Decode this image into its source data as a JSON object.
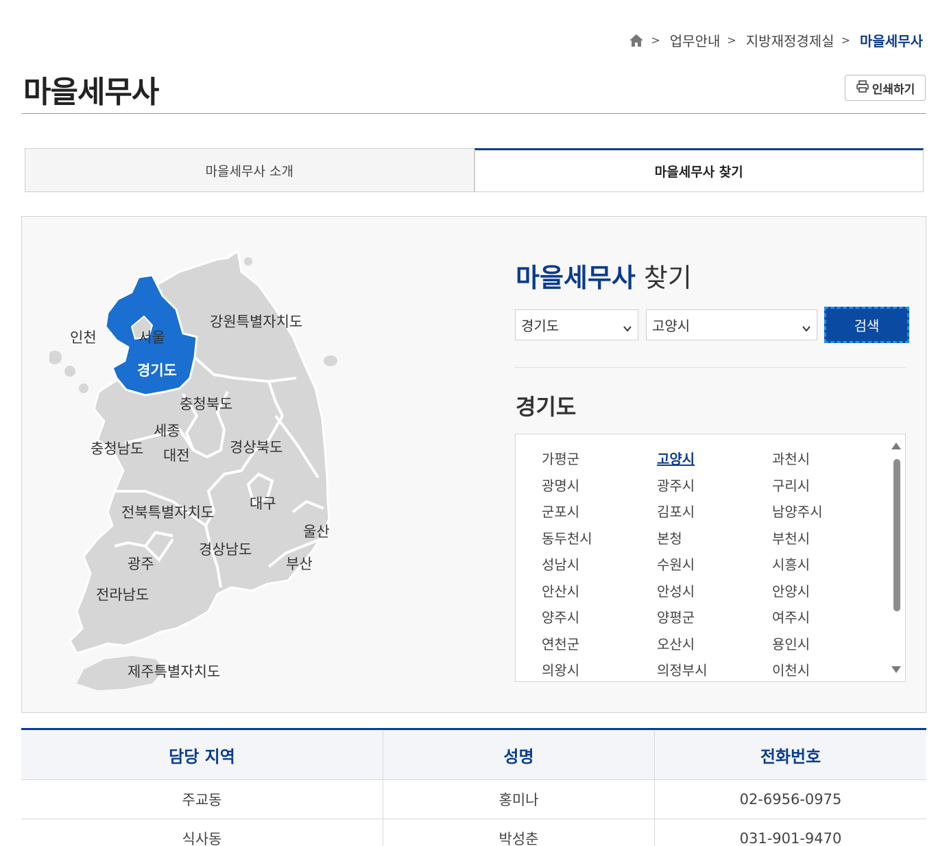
{
  "breadcrumb": {
    "items": [
      "업무안내",
      "지방재정경제실",
      "마을세무사"
    ],
    "separator": ">",
    "home_icon": "home-icon"
  },
  "page": {
    "title": "마을세무사",
    "print_label": "인쇄하기",
    "print_icon": "printer-icon"
  },
  "tabs": [
    {
      "label": "마을세무사 소개",
      "active": false
    },
    {
      "label": "마을세무사 찾기",
      "active": true
    }
  ],
  "map": {
    "selected_color": "#1a6fd0",
    "regions": [
      "인천",
      "서울",
      "경기도",
      "강원특별자치도",
      "충청북도",
      "세종",
      "충청남도",
      "대전",
      "경상북도",
      "대구",
      "전북특별자치도",
      "울산",
      "경상남도",
      "부산",
      "광주",
      "전라남도",
      "제주특별자치도"
    ],
    "selected": "경기도"
  },
  "finder": {
    "title_accent": "마을세무사",
    "title_rest": "찾기",
    "province_select": "경기도",
    "city_select": "고양시",
    "search_label": "검색",
    "region_heading": "경기도",
    "cities": [
      "가평군",
      "고양시",
      "과천시",
      "광명시",
      "광주시",
      "구리시",
      "군포시",
      "김포시",
      "남양주시",
      "동두천시",
      "본청",
      "부천시",
      "성남시",
      "수원시",
      "시흥시",
      "안산시",
      "안성시",
      "안양시",
      "양주시",
      "양평군",
      "여주시",
      "연천군",
      "오산시",
      "용인시",
      "의왕시",
      "의정부시",
      "이천시"
    ],
    "active_city": "고양시"
  },
  "results": {
    "headers": [
      "담당 지역",
      "성명",
      "전화번호"
    ],
    "rows": [
      [
        "주교동",
        "홍미나",
        "02-6956-0975"
      ],
      [
        "식사동",
        "박성춘",
        "031-901-9470"
      ]
    ]
  },
  "colors": {
    "accent": "#0b3c8c",
    "button": "#0b4aa2",
    "map_gray": "#d6d6d6"
  }
}
